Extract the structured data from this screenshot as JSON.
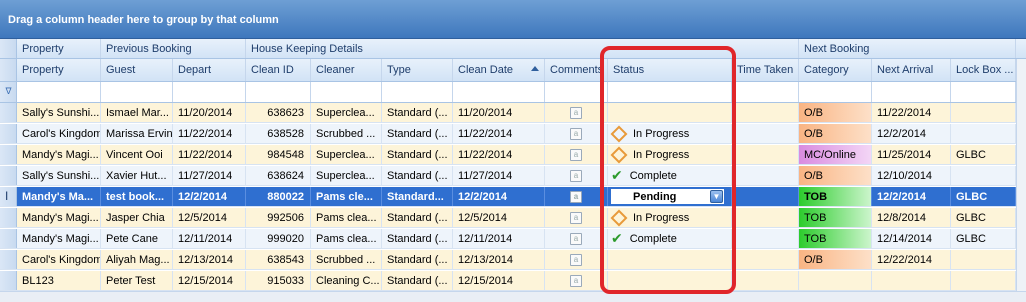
{
  "group_panel": {
    "text": "Drag a column header here to group by that column"
  },
  "bands": [
    {
      "label": "Property"
    },
    {
      "label": "Previous Booking"
    },
    {
      "label": "House Keeping Details"
    },
    {
      "label": "Next Booking"
    }
  ],
  "columns": [
    "Property",
    "Guest",
    "Depart",
    "Clean ID",
    "Cleaner",
    "Type",
    "Clean Date",
    "Comments",
    "Status",
    "Time Taken",
    "Category",
    "Next Arrival",
    "Lock Box ..."
  ],
  "status_options": {
    "pending": "Pending"
  },
  "rows": [
    {
      "property": "Sally's Sunshi...",
      "guest": "Ismael Mar...",
      "depart": "11/20/2014",
      "clean_id": "638623",
      "cleaner": "Supercleа...",
      "type": "Standard (...",
      "clean_date": "11/20/2014",
      "status": "",
      "status_icon": "",
      "time_taken": "",
      "category": "O/B",
      "category_color": "ob",
      "next_arrival": "11/22/2014",
      "lock_box": "",
      "style": "a"
    },
    {
      "property": "Carol's Kingdom",
      "guest": "Marissa Ervin",
      "depart": "11/22/2014",
      "clean_id": "638528",
      "cleaner": "Scrubbed ...",
      "type": "Standard (...",
      "clean_date": "11/22/2014",
      "status": "In Progress",
      "status_icon": "diamond",
      "time_taken": "",
      "category": "O/B",
      "category_color": "ob",
      "next_arrival": "12/2/2014",
      "lock_box": "",
      "style": "b"
    },
    {
      "property": "Mandy's Magi...",
      "guest": "Vincent Ooi",
      "depart": "11/22/2014",
      "clean_id": "984548",
      "cleaner": "Supercleа...",
      "type": "Standard (...",
      "clean_date": "11/22/2014",
      "status": "In Progress",
      "status_icon": "diamond",
      "time_taken": "",
      "category": "MC/Online",
      "category_color": "mc",
      "next_arrival": "11/25/2014",
      "lock_box": "GLBC",
      "style": "a"
    },
    {
      "property": "Sally's Sunshi...",
      "guest": "Xavier Hut...",
      "depart": "11/27/2014",
      "clean_id": "638624",
      "cleaner": "Supercleа...",
      "type": "Standard (...",
      "clean_date": "11/27/2014",
      "status": "Complete",
      "status_icon": "check",
      "time_taken": "",
      "category": "O/B",
      "category_color": "ob",
      "next_arrival": "12/10/2014",
      "lock_box": "",
      "style": "b"
    },
    {
      "property": "Mandy's Ma...",
      "guest": "test book...",
      "depart": "12/2/2014",
      "clean_id": "880022",
      "cleaner": "Pams cle...",
      "type": "Standard...",
      "clean_date": "12/2/2014",
      "status": "Pending",
      "status_icon": "edit",
      "time_taken": "",
      "category": "TOB",
      "category_color": "tob",
      "next_arrival": "12/2/2014",
      "lock_box": "GLBC",
      "style": "sel"
    },
    {
      "property": "Mandy's Magi...",
      "guest": "Jasper Chia",
      "depart": "12/5/2014",
      "clean_id": "992506",
      "cleaner": "Pams clea...",
      "type": "Standard (...",
      "clean_date": "12/5/2014",
      "status": "In Progress",
      "status_icon": "diamond",
      "time_taken": "",
      "category": "TOB",
      "category_color": "tob",
      "next_arrival": "12/8/2014",
      "lock_box": "GLBC",
      "style": "a"
    },
    {
      "property": "Mandy's Magi...",
      "guest": "Pete Cane",
      "depart": "12/11/2014",
      "clean_id": "999020",
      "cleaner": "Pams clea...",
      "type": "Standard (...",
      "clean_date": "12/11/2014",
      "status": "Complete",
      "status_icon": "check",
      "time_taken": "",
      "category": "TOB",
      "category_color": "tob",
      "next_arrival": "12/14/2014",
      "lock_box": "GLBC",
      "style": "b"
    },
    {
      "property": "Carol's Kingdom",
      "guest": "Aliyah Mag...",
      "depart": "12/13/2014",
      "clean_id": "638543",
      "cleaner": "Scrubbed ...",
      "type": "Standard (...",
      "clean_date": "12/13/2014",
      "status": "",
      "status_icon": "",
      "time_taken": "",
      "category": "O/B",
      "category_color": "ob",
      "next_arrival": "12/22/2014",
      "lock_box": "",
      "style": "a"
    },
    {
      "property": "BL123",
      "guest": "Peter Test",
      "depart": "12/15/2014",
      "clean_id": "915033",
      "cleaner": "Cleaning C...",
      "type": "Standard (...",
      "clean_date": "12/15/2014",
      "status": "",
      "status_icon": "",
      "time_taken": "",
      "category": "",
      "category_color": "",
      "next_arrival": "",
      "lock_box": "",
      "style": "a"
    }
  ]
}
